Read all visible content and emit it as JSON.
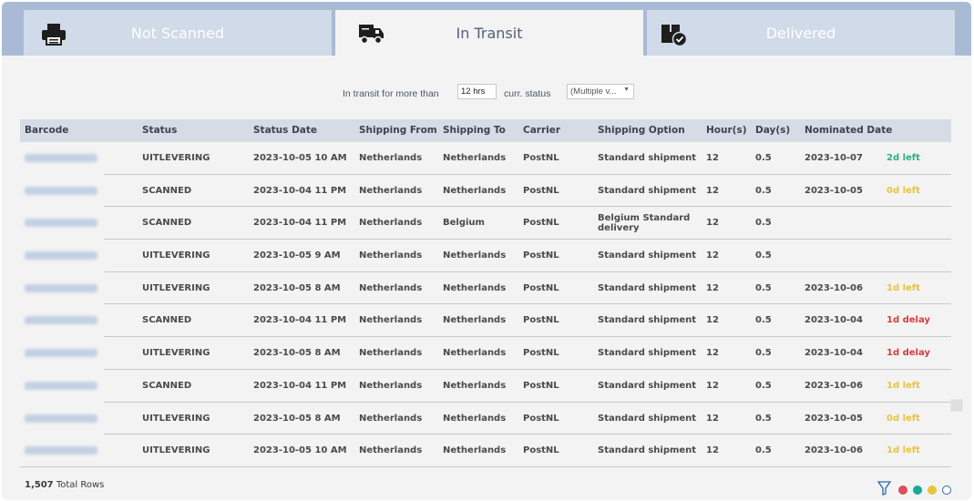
{
  "tabs": [
    {
      "label": "Not Scanned",
      "icon": "printer-icon"
    },
    {
      "label": "In Transit",
      "icon": "truck-icon"
    },
    {
      "label": "Delivered",
      "icon": "package-check-icon"
    }
  ],
  "filters": {
    "in_transit_label": "In transit for more than",
    "in_transit_value": "12 hrs",
    "status_label": "curr. status",
    "status_value": "(Multiple v..."
  },
  "table": {
    "headers": [
      "Barcode",
      "Status",
      "Status Date",
      "Shipping From",
      "Shipping To",
      "Carrier",
      "Shipping Option",
      "Hour(s)",
      "Day(s)",
      "Nominated Date"
    ],
    "rows": [
      {
        "status": "UITLEVERING",
        "date": "2023-10-05 10 AM",
        "from": "Netherlands",
        "to": "Netherlands",
        "carrier": "PostNL",
        "option": "Standard shipment",
        "hours": "12",
        "days": "0.5",
        "nominated": "2023-10-07",
        "flag": "2d left",
        "flag_color": "green"
      },
      {
        "status": "SCANNED",
        "date": "2023-10-04 11 PM",
        "from": "Netherlands",
        "to": "Netherlands",
        "carrier": "PostNL",
        "option": "Standard shipment",
        "hours": "12",
        "days": "0.5",
        "nominated": "2023-10-05",
        "flag": "0d left",
        "flag_color": "yellow"
      },
      {
        "status": "SCANNED",
        "date": "2023-10-04 11 PM",
        "from": "Netherlands",
        "to": "Belgium",
        "carrier": "PostNL",
        "option": "Belgium Standard delivery",
        "hours": "12",
        "days": "0.5",
        "nominated": "",
        "flag": "",
        "flag_color": ""
      },
      {
        "status": "UITLEVERING",
        "date": "2023-10-05 9 AM",
        "from": "Netherlands",
        "to": "Netherlands",
        "carrier": "PostNL",
        "option": "Standard shipment",
        "hours": "12",
        "days": "0.5",
        "nominated": "",
        "flag": "",
        "flag_color": ""
      },
      {
        "status": "UITLEVERING",
        "date": "2023-10-05 8 AM",
        "from": "Netherlands",
        "to": "Netherlands",
        "carrier": "PostNL",
        "option": "Standard shipment",
        "hours": "12",
        "days": "0.5",
        "nominated": "2023-10-06",
        "flag": "1d left",
        "flag_color": "yellow"
      },
      {
        "status": "SCANNED",
        "date": "2023-10-04 11 PM",
        "from": "Netherlands",
        "to": "Netherlands",
        "carrier": "PostNL",
        "option": "Standard shipment",
        "hours": "12",
        "days": "0.5",
        "nominated": "2023-10-04",
        "flag": "1d delay",
        "flag_color": "red"
      },
      {
        "status": "UITLEVERING",
        "date": "2023-10-05 8 AM",
        "from": "Netherlands",
        "to": "Netherlands",
        "carrier": "PostNL",
        "option": "Standard shipment",
        "hours": "12",
        "days": "0.5",
        "nominated": "2023-10-04",
        "flag": "1d delay",
        "flag_color": "red"
      },
      {
        "status": "SCANNED",
        "date": "2023-10-04 11 PM",
        "from": "Netherlands",
        "to": "Netherlands",
        "carrier": "PostNL",
        "option": "Standard shipment",
        "hours": "12",
        "days": "0.5",
        "nominated": "2023-10-06",
        "flag": "1d left",
        "flag_color": "yellow"
      },
      {
        "status": "UITLEVERING",
        "date": "2023-10-05 8 AM",
        "from": "Netherlands",
        "to": "Netherlands",
        "carrier": "PostNL",
        "option": "Standard shipment",
        "hours": "12",
        "days": "0.5",
        "nominated": "2023-10-05",
        "flag": "0d left",
        "flag_color": "yellow"
      },
      {
        "status": "UITLEVERING",
        "date": "2023-10-05 10 AM",
        "from": "Netherlands",
        "to": "Netherlands",
        "carrier": "PostNL",
        "option": "Standard shipment",
        "hours": "12",
        "days": "0.5",
        "nominated": "2023-10-06",
        "flag": "1d left",
        "flag_color": "yellow"
      }
    ]
  },
  "footer": {
    "total_rows": "1,507",
    "total_label": "Total Rows"
  },
  "legend": {
    "icon": "filter-icon",
    "dots": [
      "#d94f5c",
      "#16a899",
      "#e8c43a",
      "#ffffff"
    ]
  }
}
